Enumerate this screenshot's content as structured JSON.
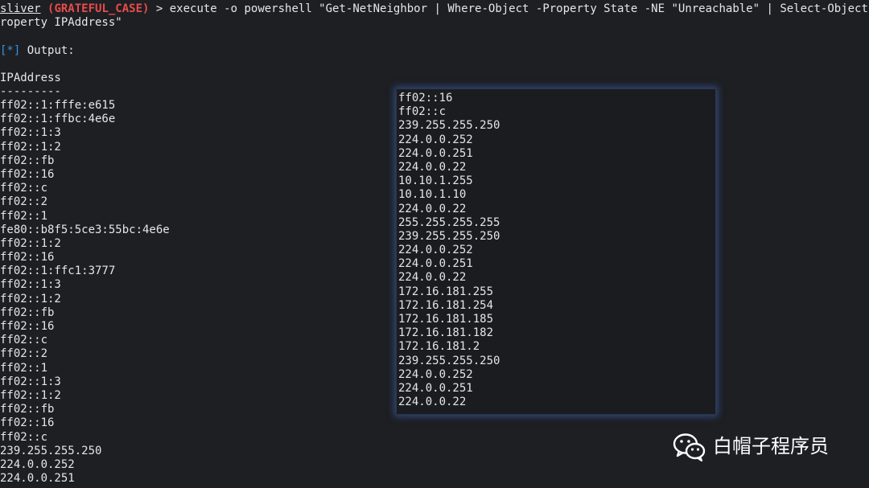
{
  "command": {
    "prompt_name": "sliver",
    "session": "(GRATEFUL_CASE)",
    "line1_rest": " > execute -o powershell \"Get-NetNeighbor | Where-Object -Property State -NE \"Unreachable\" | Select-Object -P",
    "line2": "roperty IPAddress\""
  },
  "output": {
    "status_tag": "[*]",
    "label": " Output:",
    "column_header": "IPAddress",
    "separator": "---------"
  },
  "left_rows": [
    "ff02::1:fffe:e615",
    "ff02::1:ffbc:4e6e",
    "ff02::1:3",
    "ff02::1:2",
    "ff02::fb",
    "ff02::16",
    "ff02::c",
    "ff02::2",
    "ff02::1",
    "fe80::b8f5:5ce3:55bc:4e6e",
    "ff02::1:2",
    "ff02::16",
    "ff02::1:ffc1:3777",
    "ff02::1:3",
    "ff02::1:2",
    "ff02::fb",
    "ff02::16",
    "ff02::c",
    "ff02::2",
    "ff02::1",
    "ff02::1:3",
    "ff02::1:2",
    "ff02::fb",
    "ff02::16",
    "ff02::c",
    "239.255.255.250",
    "224.0.0.252",
    "224.0.0.251"
  ],
  "right_rows": [
    "ff02::16",
    "ff02::c",
    "239.255.255.250",
    "224.0.0.252",
    "224.0.0.251",
    "224.0.0.22",
    "10.10.1.255",
    "10.10.1.10",
    "224.0.0.22",
    "255.255.255.255",
    "239.255.255.250",
    "224.0.0.252",
    "224.0.0.251",
    "224.0.0.22",
    "172.16.181.255",
    "172.16.181.254",
    "172.16.181.185",
    "172.16.181.182",
    "172.16.181.2",
    "239.255.255.250",
    "224.0.0.252",
    "224.0.0.251",
    "224.0.0.22"
  ],
  "watermark": {
    "icon": "wechat-icon",
    "text": "白帽子程序员"
  },
  "colors": {
    "background": "#1d1f23",
    "text": "#e6e6e6",
    "session": "#e94b4b",
    "status_tag": "#3b8fe0",
    "popup_glow": "#466ec8"
  }
}
